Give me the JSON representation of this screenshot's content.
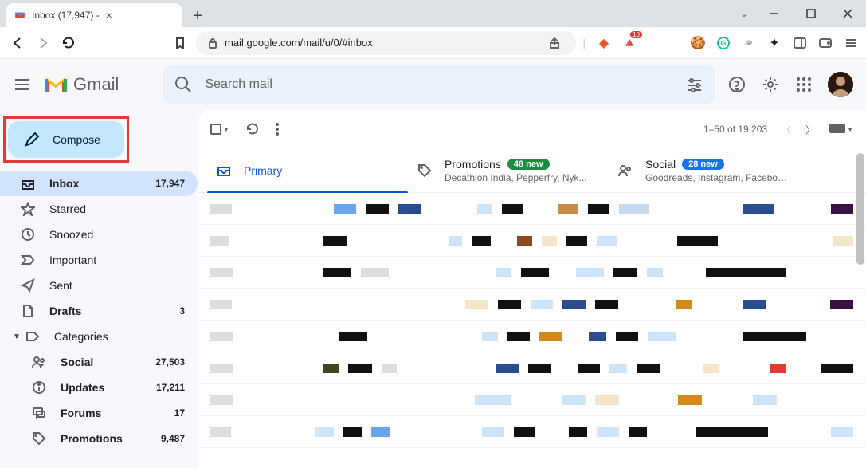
{
  "browser": {
    "tab_title": "Inbox (17,947) -",
    "url_display": "mail.google.com/mail/u/0/#inbox"
  },
  "header": {
    "logo_text": "Gmail",
    "search_placeholder": "Search mail"
  },
  "compose": {
    "label": "Compose"
  },
  "nav": {
    "inbox": {
      "label": "Inbox",
      "count": "17,947"
    },
    "starred": {
      "label": "Starred"
    },
    "snoozed": {
      "label": "Snoozed"
    },
    "important": {
      "label": "Important"
    },
    "sent": {
      "label": "Sent"
    },
    "drafts": {
      "label": "Drafts",
      "count": "3"
    },
    "categories": {
      "label": "Categories"
    },
    "social": {
      "label": "Social",
      "count": "27,503"
    },
    "updates": {
      "label": "Updates",
      "count": "17,211"
    },
    "forums": {
      "label": "Forums",
      "count": "17"
    },
    "promotions": {
      "label": "Promotions",
      "count": "9,487"
    }
  },
  "toolbar": {
    "range": "1–50 of 19,203"
  },
  "tabs": {
    "primary": {
      "label": "Primary"
    },
    "promotions": {
      "label": "Promotions",
      "badge": "48 new",
      "sub": "Decathlon India, Pepperfry, Nyk..."
    },
    "social": {
      "label": "Social",
      "badge": "28 new",
      "sub": "Goodreads, Instagram, Faceboo..."
    }
  }
}
